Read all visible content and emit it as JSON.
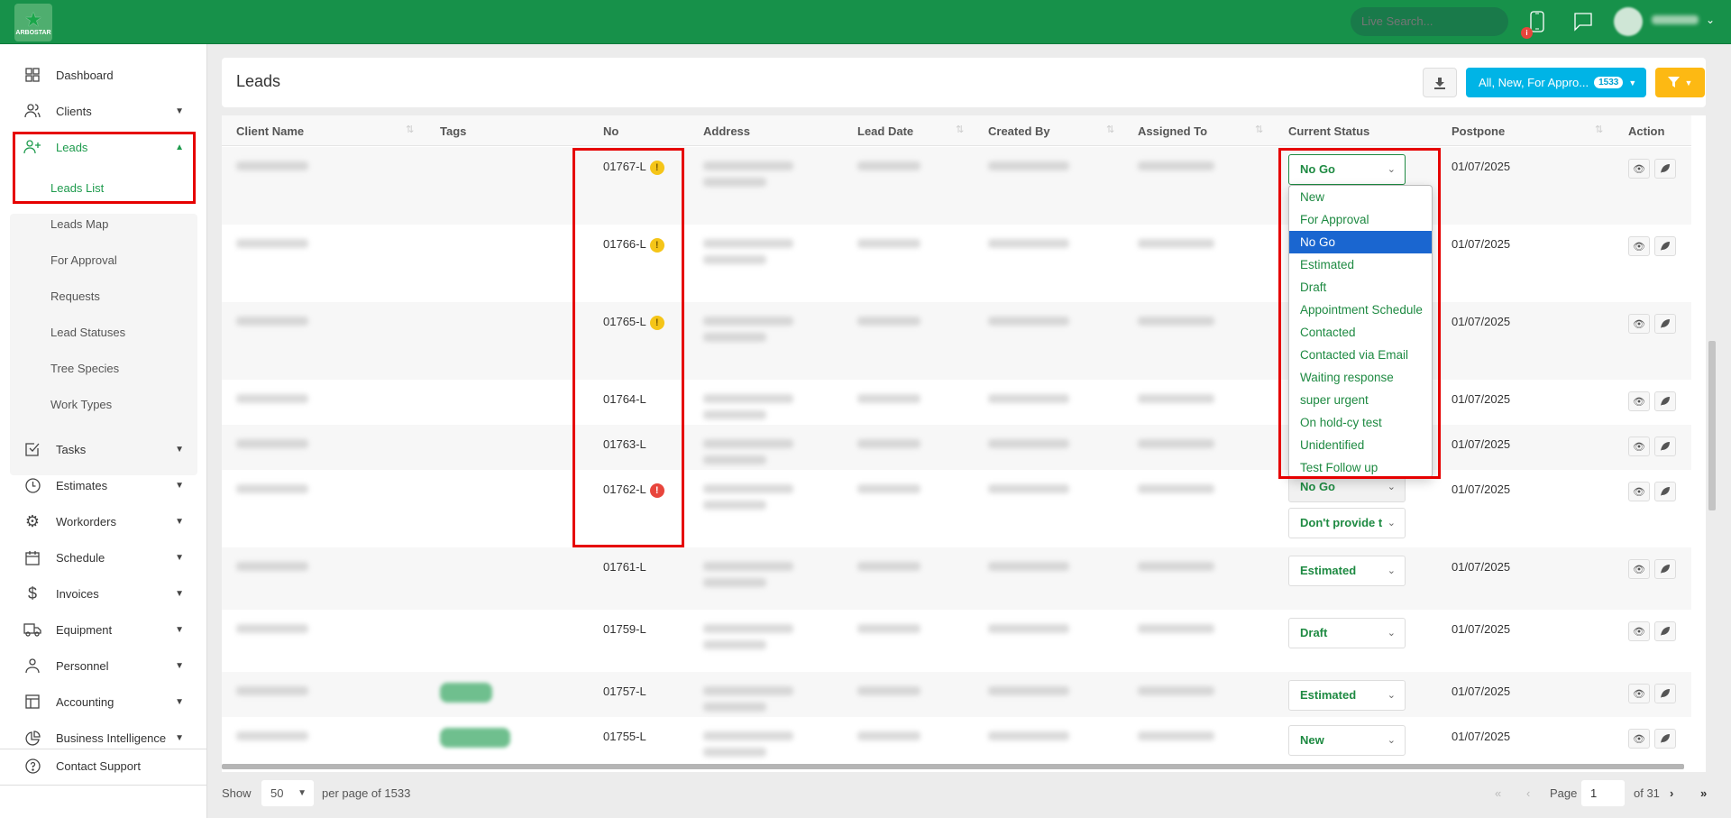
{
  "topbar": {
    "logo_text": "ARBOSTAR",
    "search_placeholder": "Live Search...",
    "notification_badge": "i",
    "user_name": "root root",
    "brand_color": "#17914a"
  },
  "sidebar": {
    "items": [
      {
        "label": "Dashboard",
        "icon": "dashboard-icon",
        "expandable": false
      },
      {
        "label": "Clients",
        "icon": "users-icon",
        "expandable": true
      },
      {
        "label": "Leads",
        "icon": "user-plus-icon",
        "expandable": true,
        "expanded": true,
        "active": true
      },
      {
        "label": "Tasks",
        "icon": "checkbox-icon",
        "expandable": true
      },
      {
        "label": "Estimates",
        "icon": "clock-icon",
        "expandable": true
      },
      {
        "label": "Workorders",
        "icon": "gear-icon",
        "expandable": true
      },
      {
        "label": "Schedule",
        "icon": "calendar-icon",
        "expandable": true
      },
      {
        "label": "Invoices",
        "icon": "dollar-icon",
        "expandable": true
      },
      {
        "label": "Equipment",
        "icon": "truck-icon",
        "expandable": true
      },
      {
        "label": "Personnel",
        "icon": "person-icon",
        "expandable": true
      },
      {
        "label": "Accounting",
        "icon": "table-icon",
        "expandable": true
      },
      {
        "label": "Business Intelligence",
        "icon": "pie-chart-icon",
        "expandable": true
      }
    ],
    "leads_submenu": [
      {
        "label": "Leads List",
        "active": true
      },
      {
        "label": "Leads Map"
      },
      {
        "label": "For Approval"
      },
      {
        "label": "Requests"
      },
      {
        "label": "Lead Statuses"
      },
      {
        "label": "Tree Species"
      },
      {
        "label": "Work Types"
      }
    ],
    "support_label": "Contact Support"
  },
  "header": {
    "title": "Leads",
    "filter_preset_label": "All, New, For Appro...",
    "filter_count": "1533",
    "accent_blue": "#00b4e6",
    "accent_yellow": "#fdb913"
  },
  "table": {
    "columns": [
      "Client Name",
      "Tags",
      "No",
      "Address",
      "Lead Date",
      "Created By",
      "Assigned To",
      "Current Status",
      "Postpone",
      "Action"
    ],
    "rows": [
      {
        "no": "01767-L",
        "flag": "warning",
        "status": "No Go",
        "postpone": "01/07/2025"
      },
      {
        "no": "01766-L",
        "flag": "warning",
        "status": "",
        "postpone": "01/07/2025"
      },
      {
        "no": "01765-L",
        "flag": "warning",
        "status": "",
        "postpone": "01/07/2025"
      },
      {
        "no": "01764-L",
        "flag": "",
        "status": "",
        "postpone": "01/07/2025"
      },
      {
        "no": "01763-L",
        "flag": "",
        "status": "",
        "postpone": "01/07/2025"
      },
      {
        "no": "01762-L",
        "flag": "error",
        "status": "No Go",
        "status2": "Don't provide t",
        "postpone": "01/07/2025"
      },
      {
        "no": "01761-L",
        "flag": "",
        "status": "Estimated",
        "postpone": "01/07/2025"
      },
      {
        "no": "01759-L",
        "flag": "",
        "status": "Draft",
        "postpone": "01/07/2025"
      },
      {
        "no": "01757-L",
        "flag": "",
        "status": "Estimated",
        "postpone": "01/07/2025"
      },
      {
        "no": "01755-L",
        "flag": "",
        "status": "New",
        "postpone": "01/07/2025"
      }
    ]
  },
  "status_dropdown": {
    "selected": "No Go",
    "options": [
      "New",
      "For Approval",
      "No Go",
      "Estimated",
      "Draft",
      "Appointment Schedule",
      "Contacted",
      "Contacted via Email",
      "Waiting response",
      "super urgent",
      "On hold-cy test",
      "Unidentified",
      "Test Follow up"
    ]
  },
  "footer": {
    "show_label": "Show",
    "per_page": "50",
    "per_page_suffix": "per page of 1533",
    "page_label": "Page",
    "page_value": "1",
    "of_label": "of 31"
  }
}
